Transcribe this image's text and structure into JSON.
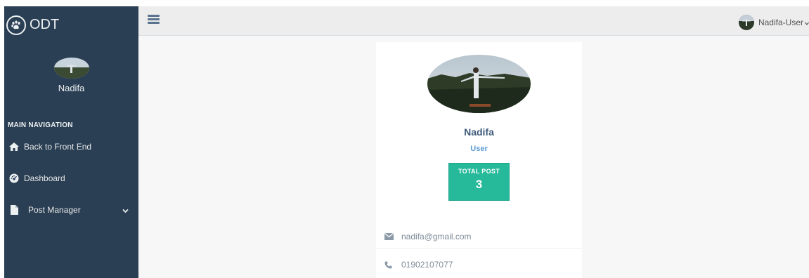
{
  "sidebar": {
    "brand": {
      "title": "ODT",
      "icon": "paw-icon"
    },
    "profile": {
      "name": "Nadifa"
    },
    "nav_heading": "MAIN NAVIGATION",
    "items": [
      {
        "label": "Back to Front End",
        "icon": "home-icon"
      },
      {
        "label": "Dashboard",
        "icon": "dashboard-icon"
      },
      {
        "label": "Post Manager",
        "icon": "file-icon",
        "has_submenu": true
      }
    ]
  },
  "topbar": {
    "menu_icon": "hamburger-icon",
    "user_label": "Nadifa-User"
  },
  "profile_card": {
    "name": "Nadifa",
    "role": "User",
    "stat": {
      "label": "TOTAL POST",
      "value": "3"
    },
    "email": "nadifa@gmail.com",
    "phone": "01902107077"
  },
  "colors": {
    "sidebar_bg": "#2a3f54",
    "topbar_bg": "#ededed",
    "main_bg": "#f7f7f7",
    "stat_bg": "#26b99a",
    "name_color": "#3e5a7a",
    "role_color": "#5b9bd5"
  }
}
